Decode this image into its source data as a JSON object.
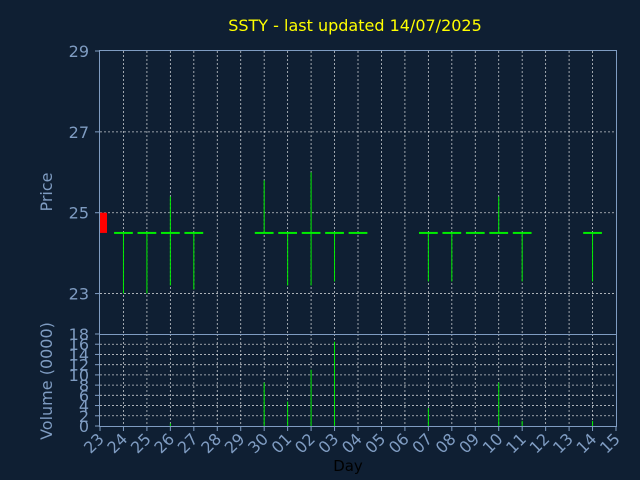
{
  "chart_data": {
    "type": "ohlc",
    "title": "SSTY - last updated 14/07/2025",
    "xlabel": "Day",
    "price_ylabel": "Price",
    "volume_ylabel": "Volume (0000)",
    "price_ylim": [
      22,
      29
    ],
    "volume_ylim": [
      0,
      18
    ],
    "price_ticks": [
      23,
      25,
      27,
      29
    ],
    "volume_ticks": [
      0,
      2,
      4,
      6,
      8,
      10,
      12,
      14,
      16,
      18
    ],
    "x_ticks": [
      "23",
      "24",
      "25",
      "26",
      "27",
      "28",
      "29",
      "30",
      "01",
      "02",
      "03",
      "04",
      "05",
      "06",
      "07",
      "08",
      "09",
      "10",
      "11",
      "12",
      "13",
      "14",
      "15"
    ],
    "colors": {
      "background": "#0f1f33",
      "bar": "#00ee00",
      "title": "#ffff00",
      "axis": "#7f9cc2",
      "marker": "#ff0000"
    },
    "marker_range": [
      24.5,
      25.0
    ],
    "bars": [
      {
        "x": 1,
        "open": 24.5,
        "high": 24.5,
        "low": 23.0,
        "close": 24.5,
        "volume": 0.0
      },
      {
        "x": 2,
        "open": 24.5,
        "high": 24.5,
        "low": 23.0,
        "close": 24.5,
        "volume": 0.0
      },
      {
        "x": 3,
        "open": 24.5,
        "high": 25.4,
        "low": 23.2,
        "close": 24.5,
        "volume": 0.5
      },
      {
        "x": 4,
        "open": 24.5,
        "high": 24.5,
        "low": 23.1,
        "close": 24.5,
        "volume": 0.0
      },
      {
        "x": 7,
        "open": 24.5,
        "high": 25.8,
        "low": 24.5,
        "close": 24.5,
        "volume": 8.5
      },
      {
        "x": 8,
        "open": 24.5,
        "high": 24.5,
        "low": 23.2,
        "close": 24.5,
        "volume": 4.8
      },
      {
        "x": 9,
        "open": 24.5,
        "high": 26.0,
        "low": 23.2,
        "close": 24.5,
        "volume": 11.0
      },
      {
        "x": 10,
        "open": 24.5,
        "high": 24.5,
        "low": 23.3,
        "close": 24.5,
        "volume": 16.5
      },
      {
        "x": 11,
        "open": 24.5,
        "high": 24.5,
        "low": 24.5,
        "close": 24.5,
        "volume": 0.0
      },
      {
        "x": 14,
        "open": 24.5,
        "high": 24.5,
        "low": 23.3,
        "close": 24.5,
        "volume": 3.5
      },
      {
        "x": 15,
        "open": 24.5,
        "high": 24.5,
        "low": 23.3,
        "close": 24.5,
        "volume": 0.0
      },
      {
        "x": 16,
        "open": 24.5,
        "high": 24.5,
        "low": 24.5,
        "close": 24.5,
        "volume": 0.0
      },
      {
        "x": 17,
        "open": 24.5,
        "high": 25.4,
        "low": 24.5,
        "close": 24.5,
        "volume": 8.5
      },
      {
        "x": 18,
        "open": 24.5,
        "high": 24.5,
        "low": 23.3,
        "close": 24.5,
        "volume": 1.0
      },
      {
        "x": 21,
        "open": 24.5,
        "high": 24.5,
        "low": 23.3,
        "close": 24.5,
        "volume": 1.0
      }
    ]
  }
}
